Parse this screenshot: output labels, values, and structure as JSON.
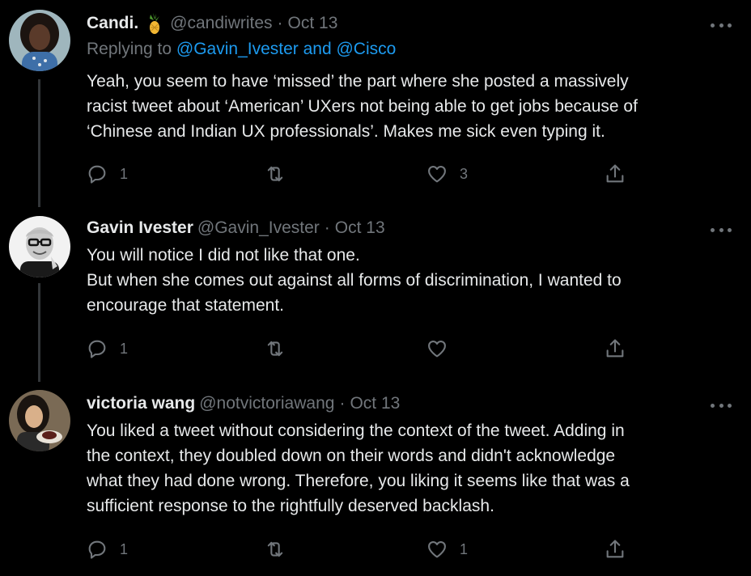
{
  "colors": {
    "background": "#000000",
    "text": "#e7e9ea",
    "muted": "#71767b",
    "link": "#1d9bf0",
    "thread_line": "#333639"
  },
  "tweets": [
    {
      "name": "Candi.",
      "name_emoji": "pineapple-emoji",
      "handle": "@candiwrites",
      "time": "Oct 13",
      "replying_prefix": "Replying to",
      "replying_to": "@Gavin_Ivester and @Cisco",
      "text": "Yeah, you seem to have ‘missed’ the part where she posted a massively\nracist tweet about ‘American’ UXers not being able to get jobs because of\n‘Chinese and Indian UX professionals’. Makes me sick even typing it.",
      "replies": "1",
      "retweets": "",
      "likes": "3",
      "icons": {
        "more": "more-icon",
        "reply": "reply-icon",
        "retweet": "retweet-icon",
        "like": "like-icon",
        "share": "share-icon"
      }
    },
    {
      "name": "Gavin Ivester",
      "handle": "@Gavin_Ivester",
      "time": "Oct 13",
      "text": "You will notice I did not like that one.\nBut when she comes out against all forms of discrimination, I wanted to\nencourage that statement.",
      "replies": "1",
      "retweets": "",
      "likes": ""
    },
    {
      "name": "victoria wang",
      "handle": "@notvictoriawang",
      "time": "Oct 13",
      "text": "You liked a tweet without considering the context of the tweet. Adding in\nthe context, they doubled down on their words and didn't acknowledge\nwhat they had done wrong. Therefore, you liking it seems like that was a\nsufficient response to the rightfully deserved backlash.",
      "replies": "1",
      "retweets": "",
      "likes": "1"
    }
  ],
  "separator": "·"
}
